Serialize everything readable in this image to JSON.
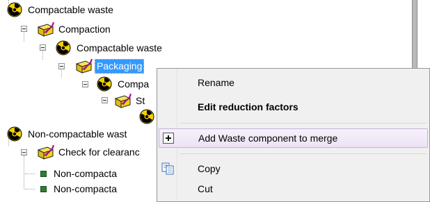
{
  "tree": {
    "nodes": [
      {
        "label": "Compactable waste",
        "icon": "radiation-icon"
      },
      {
        "label": "Compaction",
        "icon": "process-box-icon"
      },
      {
        "label": "Compactable waste",
        "icon": "radiation-icon"
      },
      {
        "label": "Packaging",
        "icon": "process-box-icon",
        "selected": true
      },
      {
        "label": "Compa",
        "icon": "radiation-icon"
      },
      {
        "label": "St",
        "icon": "process-box-icon"
      },
      {
        "label": "",
        "icon": "radiation-icon"
      },
      {
        "label": "Non-compactable wast",
        "icon": "radiation-icon"
      },
      {
        "label": "Check for clearanc",
        "icon": "process-box-icon"
      },
      {
        "label": "Non-compacta",
        "icon": "leaf-square-icon"
      },
      {
        "label": "Non-compacta",
        "icon": "leaf-square-icon"
      }
    ]
  },
  "context_menu": {
    "items": [
      {
        "label": "Rename",
        "bold": false
      },
      {
        "label": "Edit reduction factors",
        "bold": true
      },
      {
        "label": "Add Waste component to merge",
        "icon": "plus-icon",
        "hover": true
      },
      {
        "label": "Copy",
        "icon": "copy-icon"
      },
      {
        "label": "Cut"
      }
    ]
  },
  "colors": {
    "selection": "#3399ff",
    "radiation_yellow": "#f3d100",
    "folder_yellow": "#f3d40d",
    "menu_background": "#f0f0f0",
    "menu_hover": "#ece2f4"
  }
}
